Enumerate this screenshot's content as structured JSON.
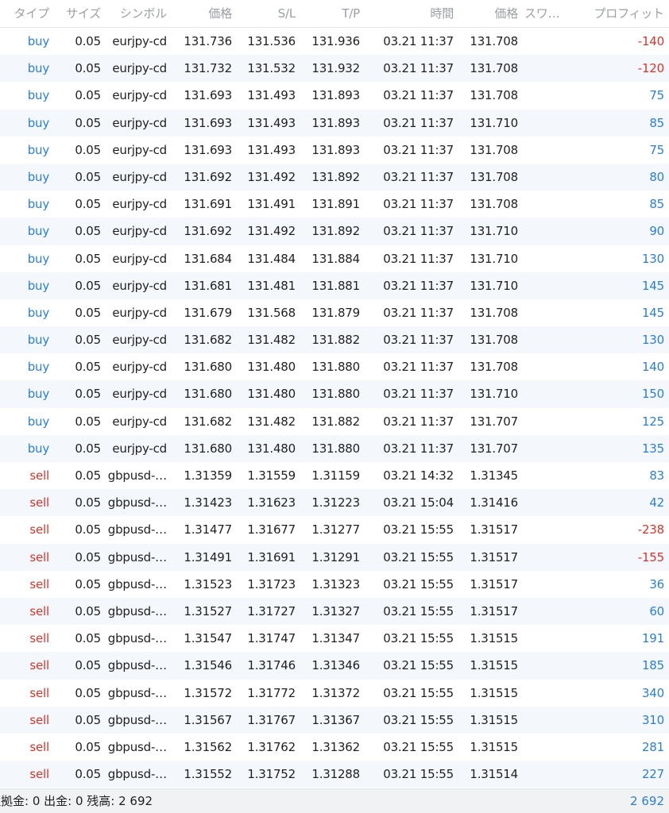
{
  "headers": {
    "type": "タイプ",
    "size": "サイズ",
    "symbol": "シンボル",
    "price": "価格",
    "sl": "S/L",
    "tp": "T/P",
    "time": "時間",
    "current_price": "価格",
    "swap": "スワ…",
    "profit": "プロフィット"
  },
  "rows": [
    {
      "type": "buy",
      "size": "0.05",
      "symbol": "eurjpy-cd",
      "price": "131.736",
      "sl": "131.536",
      "tp": "131.936",
      "time": "03.21 11:37",
      "current": "131.708",
      "profit": "-140"
    },
    {
      "type": "buy",
      "size": "0.05",
      "symbol": "eurjpy-cd",
      "price": "131.732",
      "sl": "131.532",
      "tp": "131.932",
      "time": "03.21 11:37",
      "current": "131.708",
      "profit": "-120"
    },
    {
      "type": "buy",
      "size": "0.05",
      "symbol": "eurjpy-cd",
      "price": "131.693",
      "sl": "131.493",
      "tp": "131.893",
      "time": "03.21 11:37",
      "current": "131.708",
      "profit": "75"
    },
    {
      "type": "buy",
      "size": "0.05",
      "symbol": "eurjpy-cd",
      "price": "131.693",
      "sl": "131.493",
      "tp": "131.893",
      "time": "03.21 11:37",
      "current": "131.710",
      "profit": "85"
    },
    {
      "type": "buy",
      "size": "0.05",
      "symbol": "eurjpy-cd",
      "price": "131.693",
      "sl": "131.493",
      "tp": "131.893",
      "time": "03.21 11:37",
      "current": "131.708",
      "profit": "75"
    },
    {
      "type": "buy",
      "size": "0.05",
      "symbol": "eurjpy-cd",
      "price": "131.692",
      "sl": "131.492",
      "tp": "131.892",
      "time": "03.21 11:37",
      "current": "131.708",
      "profit": "80"
    },
    {
      "type": "buy",
      "size": "0.05",
      "symbol": "eurjpy-cd",
      "price": "131.691",
      "sl": "131.491",
      "tp": "131.891",
      "time": "03.21 11:37",
      "current": "131.708",
      "profit": "85"
    },
    {
      "type": "buy",
      "size": "0.05",
      "symbol": "eurjpy-cd",
      "price": "131.692",
      "sl": "131.492",
      "tp": "131.892",
      "time": "03.21 11:37",
      "current": "131.710",
      "profit": "90"
    },
    {
      "type": "buy",
      "size": "0.05",
      "symbol": "eurjpy-cd",
      "price": "131.684",
      "sl": "131.484",
      "tp": "131.884",
      "time": "03.21 11:37",
      "current": "131.710",
      "profit": "130"
    },
    {
      "type": "buy",
      "size": "0.05",
      "symbol": "eurjpy-cd",
      "price": "131.681",
      "sl": "131.481",
      "tp": "131.881",
      "time": "03.21 11:37",
      "current": "131.710",
      "profit": "145"
    },
    {
      "type": "buy",
      "size": "0.05",
      "symbol": "eurjpy-cd",
      "price": "131.679",
      "sl": "131.568",
      "tp": "131.879",
      "time": "03.21 11:37",
      "current": "131.708",
      "profit": "145"
    },
    {
      "type": "buy",
      "size": "0.05",
      "symbol": "eurjpy-cd",
      "price": "131.682",
      "sl": "131.482",
      "tp": "131.882",
      "time": "03.21 11:37",
      "current": "131.708",
      "profit": "130"
    },
    {
      "type": "buy",
      "size": "0.05",
      "symbol": "eurjpy-cd",
      "price": "131.680",
      "sl": "131.480",
      "tp": "131.880",
      "time": "03.21 11:37",
      "current": "131.708",
      "profit": "140"
    },
    {
      "type": "buy",
      "size": "0.05",
      "symbol": "eurjpy-cd",
      "price": "131.680",
      "sl": "131.480",
      "tp": "131.880",
      "time": "03.21 11:37",
      "current": "131.710",
      "profit": "150"
    },
    {
      "type": "buy",
      "size": "0.05",
      "symbol": "eurjpy-cd",
      "price": "131.682",
      "sl": "131.482",
      "tp": "131.882",
      "time": "03.21 11:37",
      "current": "131.707",
      "profit": "125"
    },
    {
      "type": "buy",
      "size": "0.05",
      "symbol": "eurjpy-cd",
      "price": "131.680",
      "sl": "131.480",
      "tp": "131.880",
      "time": "03.21 11:37",
      "current": "131.707",
      "profit": "135"
    },
    {
      "type": "sell",
      "size": "0.05",
      "symbol": "gbpusd-…",
      "price": "1.31359",
      "sl": "1.31559",
      "tp": "1.31159",
      "time": "03.21 14:32",
      "current": "1.31345",
      "profit": "83"
    },
    {
      "type": "sell",
      "size": "0.05",
      "symbol": "gbpusd-…",
      "price": "1.31423",
      "sl": "1.31623",
      "tp": "1.31223",
      "time": "03.21 15:04",
      "current": "1.31416",
      "profit": "42"
    },
    {
      "type": "sell",
      "size": "0.05",
      "symbol": "gbpusd-…",
      "price": "1.31477",
      "sl": "1.31677",
      "tp": "1.31277",
      "time": "03.21 15:55",
      "current": "1.31517",
      "profit": "-238"
    },
    {
      "type": "sell",
      "size": "0.05",
      "symbol": "gbpusd-…",
      "price": "1.31491",
      "sl": "1.31691",
      "tp": "1.31291",
      "time": "03.21 15:55",
      "current": "1.31517",
      "profit": "-155"
    },
    {
      "type": "sell",
      "size": "0.05",
      "symbol": "gbpusd-…",
      "price": "1.31523",
      "sl": "1.31723",
      "tp": "1.31323",
      "time": "03.21 15:55",
      "current": "1.31517",
      "profit": "36"
    },
    {
      "type": "sell",
      "size": "0.05",
      "symbol": "gbpusd-…",
      "price": "1.31527",
      "sl": "1.31727",
      "tp": "1.31327",
      "time": "03.21 15:55",
      "current": "1.31517",
      "profit": "60"
    },
    {
      "type": "sell",
      "size": "0.05",
      "symbol": "gbpusd-…",
      "price": "1.31547",
      "sl": "1.31747",
      "tp": "1.31347",
      "time": "03.21 15:55",
      "current": "1.31515",
      "profit": "191"
    },
    {
      "type": "sell",
      "size": "0.05",
      "symbol": "gbpusd-…",
      "price": "1.31546",
      "sl": "1.31746",
      "tp": "1.31346",
      "time": "03.21 15:55",
      "current": "1.31515",
      "profit": "185"
    },
    {
      "type": "sell",
      "size": "0.05",
      "symbol": "gbpusd-…",
      "price": "1.31572",
      "sl": "1.31772",
      "tp": "1.31372",
      "time": "03.21 15:55",
      "current": "1.31515",
      "profit": "340"
    },
    {
      "type": "sell",
      "size": "0.05",
      "symbol": "gbpusd-…",
      "price": "1.31567",
      "sl": "1.31767",
      "tp": "1.31367",
      "time": "03.21 15:55",
      "current": "1.31515",
      "profit": "310"
    },
    {
      "type": "sell",
      "size": "0.05",
      "symbol": "gbpusd-…",
      "price": "1.31562",
      "sl": "1.31762",
      "tp": "1.31362",
      "time": "03.21 15:55",
      "current": "1.31515",
      "profit": "281"
    },
    {
      "type": "sell",
      "size": "0.05",
      "symbol": "gbpusd-…",
      "price": "1.31552",
      "sl": "1.31752",
      "tp": "1.31288",
      "time": "03.21 15:55",
      "current": "1.31514",
      "profit": "227"
    }
  ],
  "footer": {
    "summary": "証拠金: 0 出金: 0 残高: 2 692",
    "total": "2 692"
  },
  "colors": {
    "buy": "#2b7fd1",
    "sell": "#d9342b",
    "profit_positive": "#2b7fd1",
    "profit_negative": "#d9342b"
  }
}
